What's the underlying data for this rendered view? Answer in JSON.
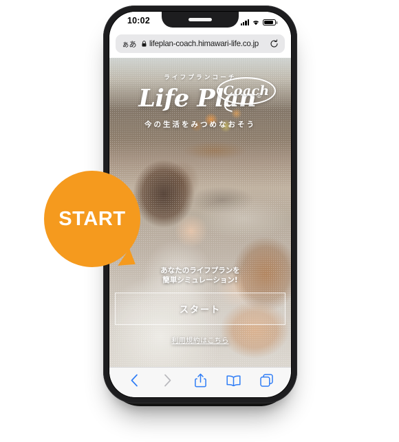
{
  "status_bar": {
    "time": "10:02",
    "signal_icon": "cellular-bars-icon",
    "wifi_icon": "wifi-icon",
    "battery_icon": "battery-icon"
  },
  "browser": {
    "text_size_button": "ぁあ",
    "lock_icon": "lock-icon",
    "url": "lifeplan-coach.himawari-life.co.jp",
    "reload_icon": "reload-icon",
    "toolbar": {
      "back_label": "back-icon",
      "forward_label": "forward-icon",
      "share_label": "share-icon",
      "bookmarks_label": "bookmarks-icon",
      "tabs_label": "tabs-icon",
      "back_enabled_color": "#2f7df6",
      "forward_disabled_color": "#b9b9bd"
    }
  },
  "page": {
    "logo": {
      "kicker": "ライフプランコーチ",
      "title": "Life Plan",
      "registered_mark": "®",
      "badge": "Coach"
    },
    "tagline": "今の生活をみつめなおそう",
    "cta": {
      "lead_line1": "あなたのライフプランを",
      "lead_line2": "簡単シミュレーション!",
      "start_button": "スタート",
      "terms_link": "利用規約はこちら"
    }
  },
  "callout": {
    "label": "START",
    "color": "#F59A1E"
  }
}
